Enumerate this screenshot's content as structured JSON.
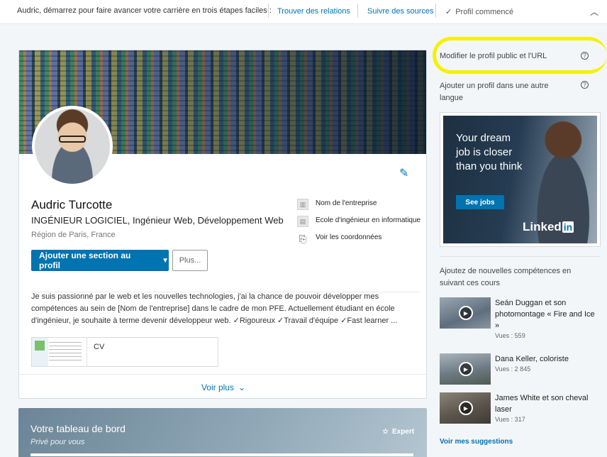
{
  "topbar": {
    "intro": "Audric, démarrez pour faire avancer votre carrière en trois étapes faciles :",
    "link_relations": "Trouver des relations",
    "link_sources": "Suivre des sources",
    "done_label": "Profil commencé"
  },
  "profile": {
    "name": "Audric Turcotte",
    "headline": "INGÉNIEUR LOGICIEL, Ingénieur Web, Développement Web",
    "location": "Région de Paris, France",
    "facts": {
      "company": "Nom de l'entreprise",
      "school": "Ecole d'ingénieur en informatique",
      "contact": "Voir les coordonnées"
    },
    "add_section_button": "Ajouter une section au profil",
    "more_button": "Plus...",
    "summary": "Je suis passionné par le web et les nouvelles technologies, j'ai la chance de pouvoir développer mes compétences au sein de [Nom de l'entreprise] dans le cadre de mon PFE. Actuellement étudiant en école d'ingénieur, je souhaite à terme devenir développeur web. ✓Rigoureux ✓Travail d'équipe ✓Fast learner ...",
    "document_label": "CV",
    "see_more": "Voir plus"
  },
  "dashboard": {
    "title": "Votre tableau de bord",
    "subtitle": "Privé pour vous",
    "expert_label": "Expert"
  },
  "rail": {
    "edit_public_profile": "Modifier le profil public et l'URL",
    "add_language_profile": "Ajouter un profil dans une autre langue",
    "ad": {
      "copy": "Your dream job is closer than you think",
      "cta": "See jobs",
      "logo_text": "Linked",
      "logo_in": "in"
    },
    "courses_title": "Ajoutez de nouvelles compétences en suivant ces cours",
    "courses": [
      {
        "title": "Seán Duggan et son photomontage « Fire and Ice »",
        "views": "Vues : 559"
      },
      {
        "title": "Dana Keller, coloriste",
        "views": "Vues : 2 845"
      },
      {
        "title": "James White et son cheval laser",
        "views": "Vues : 317"
      }
    ],
    "suggestions_link": "Voir mes suggestions"
  },
  "colors": {
    "accent": "#0073b1",
    "highlight": "#f5f100"
  },
  "icons": [
    "checkmark-icon",
    "chevron-down-icon",
    "pencil-icon",
    "building-icon",
    "school-icon",
    "contact-card-icon",
    "caret-down-icon",
    "help-icon",
    "play-icon",
    "star-icon"
  ]
}
